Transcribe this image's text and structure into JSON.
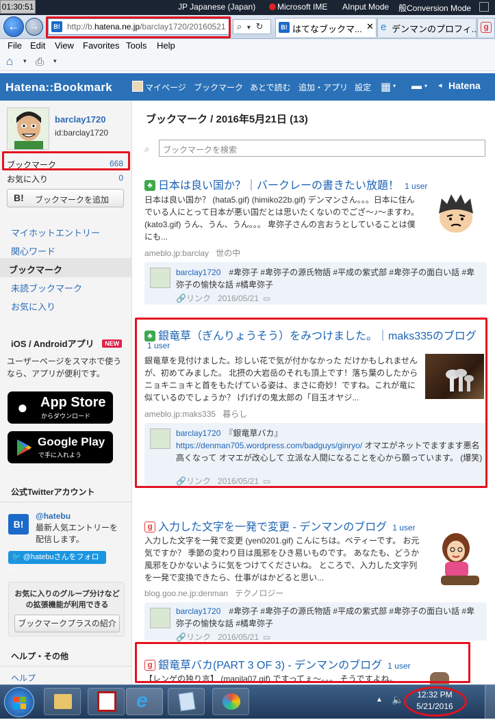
{
  "system": {
    "clock": "01:30:51",
    "lang_items": [
      "JP Japanese (Japan)",
      "Microsoft IME",
      "Input Mode",
      "Conversion Mode"
    ],
    "ime_glyph": "般"
  },
  "browser": {
    "url_prefix": "http://b.",
    "url_host": "hatena.ne.jp",
    "url_rest": "/barclay1720/20160521",
    "tabs": [
      "はてなブックマ...",
      "デンマンのプロフィ...",
      "g"
    ],
    "menu": [
      "File",
      "Edit",
      "View",
      "Favorites",
      "Tools",
      "Help"
    ]
  },
  "header": {
    "logo": "Hatena::Bookmark",
    "nav": [
      "マイページ",
      "ブックマーク",
      "あとで読む",
      "追加・アプリ",
      "設定"
    ],
    "brand": "Hatena"
  },
  "sidebar": {
    "username": "barclay1720",
    "user_id": "id:barclay1720",
    "bookmark_label": "ブックマーク",
    "bookmark_count": "668",
    "fav_label": "お気に入り",
    "fav_count": "0",
    "add_button": "ブックマークを追加",
    "links": [
      "マイホットエントリー",
      "関心ワード",
      "ブックマーク",
      "未読ブックマーク",
      "お気に入り"
    ],
    "apps_heading": "iOS / Androidアプリ",
    "new_badge": "NEW",
    "apps_desc": "ユーザーページをスマホで使うなら、アプリが便利です。",
    "appstore_main": "App Store",
    "appstore_sub": "からダウンロード",
    "gplay_main": "Google Play",
    "gplay_sub": "で手に入れよう",
    "twitter_heading": "公式Twitterアカウント",
    "twitter_handle": "@hatebu",
    "twitter_desc": "最新人気エントリーを配信します。",
    "follow_button": "@hatebuさんをフォロー",
    "plus_desc": "お気に入りのグループ分けなどの拡張機能が利用できる",
    "plus_button": "ブックマークプラスの紹介",
    "help_heading": "ヘルプ・その他",
    "help_link": "ヘルプ"
  },
  "main": {
    "heading": "ブックマーク / 2016年5月21日 (13)",
    "search_placeholder": "ブックマークを検索",
    "entries": [
      {
        "title": "日本は良い国か？｜バークレーの書きたい放題！",
        "users": "1 user",
        "snippet": "日本は良い国か？ (hata5.gif) (himiko22b.gif) デンマンさん。。。日本に住んでいる人にとって日本が悪い国だとは思いたくないのでござ～♪～ますわ。 (kato3.gif) うん、うん、うん。。。 卑弥子さんの言おうとしていることは僕にも...",
        "domain": "ameblo.jp:barclay",
        "category": "世の中",
        "comment_user": "barclay1720",
        "comment": "#卑弥子 #卑弥子の源氏物語 #平成の紫式部 #卑弥子の面白い話 #卑弥子の愉快な話 #橘卑弥子",
        "link_label": "リンク",
        "date": "2016/05/21"
      },
      {
        "title": "銀竜草（ぎんりょうそう）をみつけました。｜maks335のブログ",
        "users": "1 user",
        "snippet": "銀竜草を見付けました。珍しい花で気が付かなかった だけかもしれませんが、初めてみました。 北摂の大岩岳のそれも頂上です！落ち葉のしたから ニョキニョキと首をもたげている姿は、まさに奇妙！ですね。これが竜に似ているのでしょうか？ げげげの鬼太郎の「目玉オヤジ...",
        "domain": "ameblo.jp:maks335",
        "category": "暮らし",
        "comment_user": "barclay1720",
        "comment_title": "『銀竜草バカ』",
        "comment_url": "https://denman705.wordpress.com/badguys/ginryo/",
        "comment": "オマエがネットでますます悪名高くなって オマエが改心して 立派な人間になることを心から願っています。 (爆笑)",
        "link_label": "リンク",
        "date": "2016/05/21"
      },
      {
        "title": "入力した文字を一発で変更 - デンマンのブログ",
        "users": "1 user",
        "snippet": "入力した文字を一発で変更 (yen0201.gif) こんにちは。ベティーです。 お元気ですか？ 季節の変わり目は風邪をひき易いものです。 あなたも、どうか風邪をひかないように気をつけてくださいね。 ところで、入力した文字列を一発で変換できたら、仕事がはかどると思い...",
        "domain": "blog.goo.ne.jp:denman",
        "category": "テクノロジー",
        "comment_user": "barclay1720",
        "comment": "#卑弥子 #卑弥子の源氏物語 #平成の紫式部 #卑弥子の面白い話 #卑弥子の愉快な話 #橘卑弥子",
        "link_label": "リンク",
        "date": "2016/05/21"
      },
      {
        "title": "銀竜草バカ(PART 3 OF 3) - デンマンのブログ",
        "users": "1 user",
        "snippet": "【レンゲの独り言】 (manila07.gif) ですってぇ～。。。 そうですよね。"
      }
    ]
  },
  "taskbar": {
    "time": "12:32 PM",
    "date": "5/21/2016"
  },
  "colors": {
    "hatena_blue": "#2b71b8",
    "annotation_red": "#e3121f",
    "link_blue": "#1c63b5"
  }
}
